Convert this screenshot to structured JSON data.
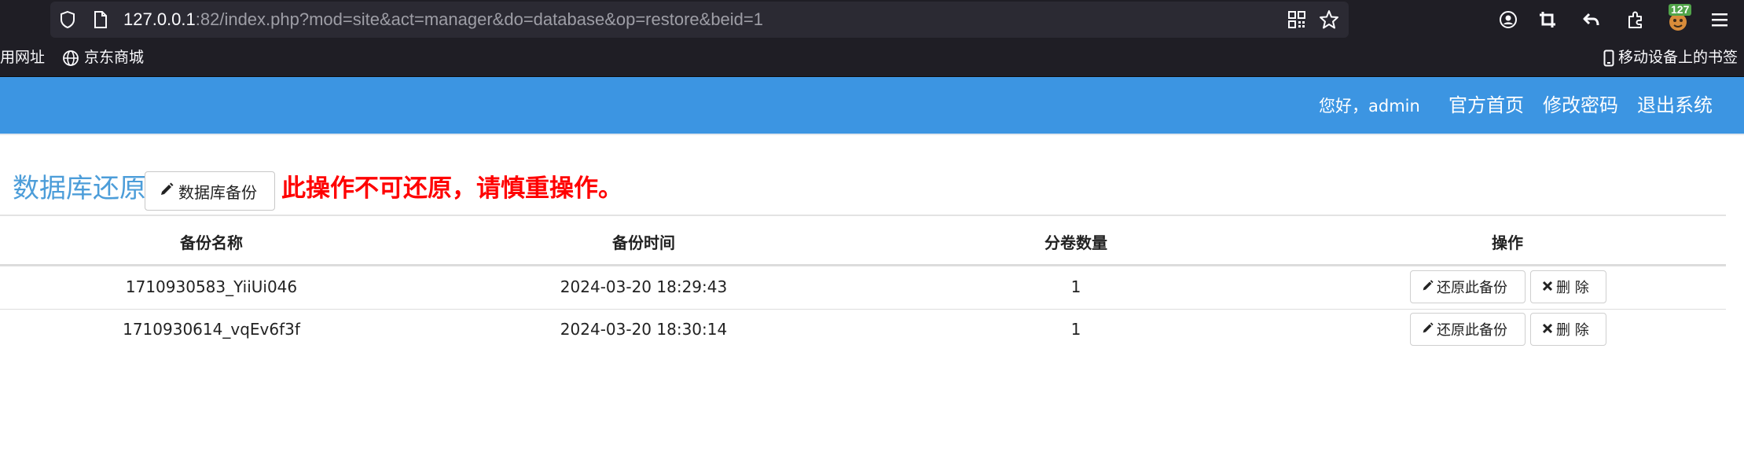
{
  "browser": {
    "url_host": "127.0.0.1",
    "url_rest": ":82/index.php?mod=site&act=manager&do=database&op=restore&beid=1",
    "extension_badge": "127",
    "bookmarks": {
      "left_item": "常用网址",
      "jd": "京东商城",
      "mobile": "移动设备上的书签"
    }
  },
  "header": {
    "greeting": "您好，admin",
    "nav": {
      "home": "官方首页",
      "change_password": "修改密码",
      "logout": "退出系统"
    }
  },
  "page": {
    "title": "数据库还原",
    "backup_button": "数据库备份",
    "warning": "此操作不可还原，请慎重操作。"
  },
  "table": {
    "headers": [
      "备份名称",
      "备份时间",
      "分卷数量",
      "操作"
    ],
    "rows": [
      {
        "name": "1710930583_YiiUi046",
        "time": "2024-03-20 18:29:43",
        "volumes": "1",
        "restore": "还原此备份",
        "delete": "删 除"
      },
      {
        "name": "1710930614_vqEv6f3f",
        "time": "2024-03-20 18:30:14",
        "volumes": "1",
        "restore": "还原此备份",
        "delete": "删 除"
      }
    ]
  },
  "colors": {
    "header_bg": "#3c95e2",
    "title": "#4c9dd9",
    "warning": "#ff0000",
    "chrome_bg": "#1f1e25"
  }
}
